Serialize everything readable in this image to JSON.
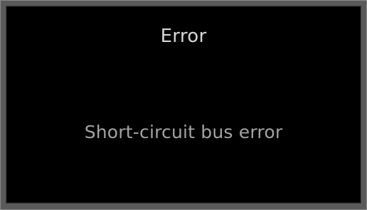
{
  "dialog": {
    "title": "Error",
    "message": "Short-circuit bus error"
  },
  "colors": {
    "background": "#000000",
    "title_text": "#d6d6d6",
    "message_text": "#a3a3a3",
    "frame": "#5a5a5a"
  }
}
